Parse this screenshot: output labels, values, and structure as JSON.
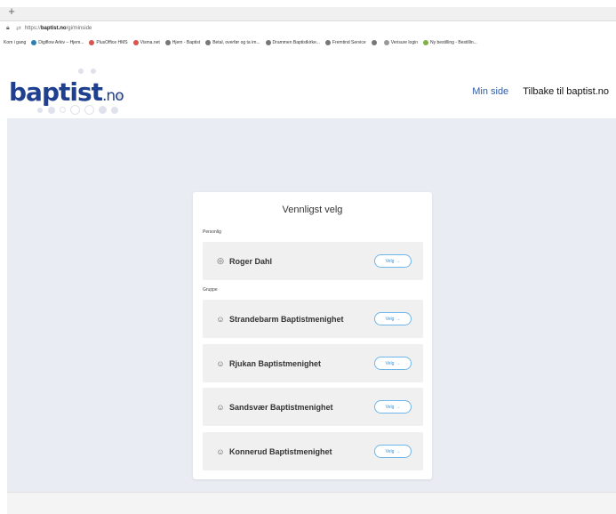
{
  "browser": {
    "new_tab": "+",
    "url_prefix": "https://",
    "url_domain": "baptist.no",
    "url_path": "/gi/minside",
    "bookmarks": [
      {
        "label": "Kom i gang",
        "color": ""
      },
      {
        "label": "Digiflow Arkiv – Hjem...",
        "color": "#2a7fb8"
      },
      {
        "label": "PlusOffice HMS",
        "color": "#d9534f"
      },
      {
        "label": "Visma.net",
        "color": "#d9534f"
      },
      {
        "label": "Hjem - Baptist",
        "color": "#777777"
      },
      {
        "label": "Betal, overfør og ta im...",
        "color": "#777777"
      },
      {
        "label": "Drammen Baptistkirke...",
        "color": "#777777"
      },
      {
        "label": "Fremtind Service",
        "color": "#777777"
      },
      {
        "label": "",
        "color": "#777777"
      },
      {
        "label": "Verisure login",
        "color": "#999999"
      },
      {
        "label": "Ny bestilling - Bestillin...",
        "color": "#7cb342"
      }
    ]
  },
  "site": {
    "logo_main": "baptist",
    "logo_tld": ".no",
    "nav_min_side": "Min side",
    "nav_back": "Tilbake til baptist.no"
  },
  "card": {
    "title": "Vennligst velg",
    "personal_label": "Personlig",
    "group_label": "Gruppe",
    "button_label": "Velg",
    "person": {
      "name": "Roger Dahl",
      "icon": "user-circle-icon"
    },
    "groups": [
      {
        "name": "Strandebarm Baptistmenighet",
        "icon": "group-icon"
      },
      {
        "name": "Rjukan Baptistmenighet",
        "icon": "group-icon"
      },
      {
        "name": "Sandsvær Baptistmenighet",
        "icon": "group-icon"
      },
      {
        "name": "Konnerud Baptistmenighet",
        "icon": "group-icon"
      }
    ]
  },
  "colors": {
    "brand": "#1f3f8f",
    "link": "#2f5ca8",
    "button_border": "#6fb6ea",
    "background": "#e9ecf3"
  }
}
